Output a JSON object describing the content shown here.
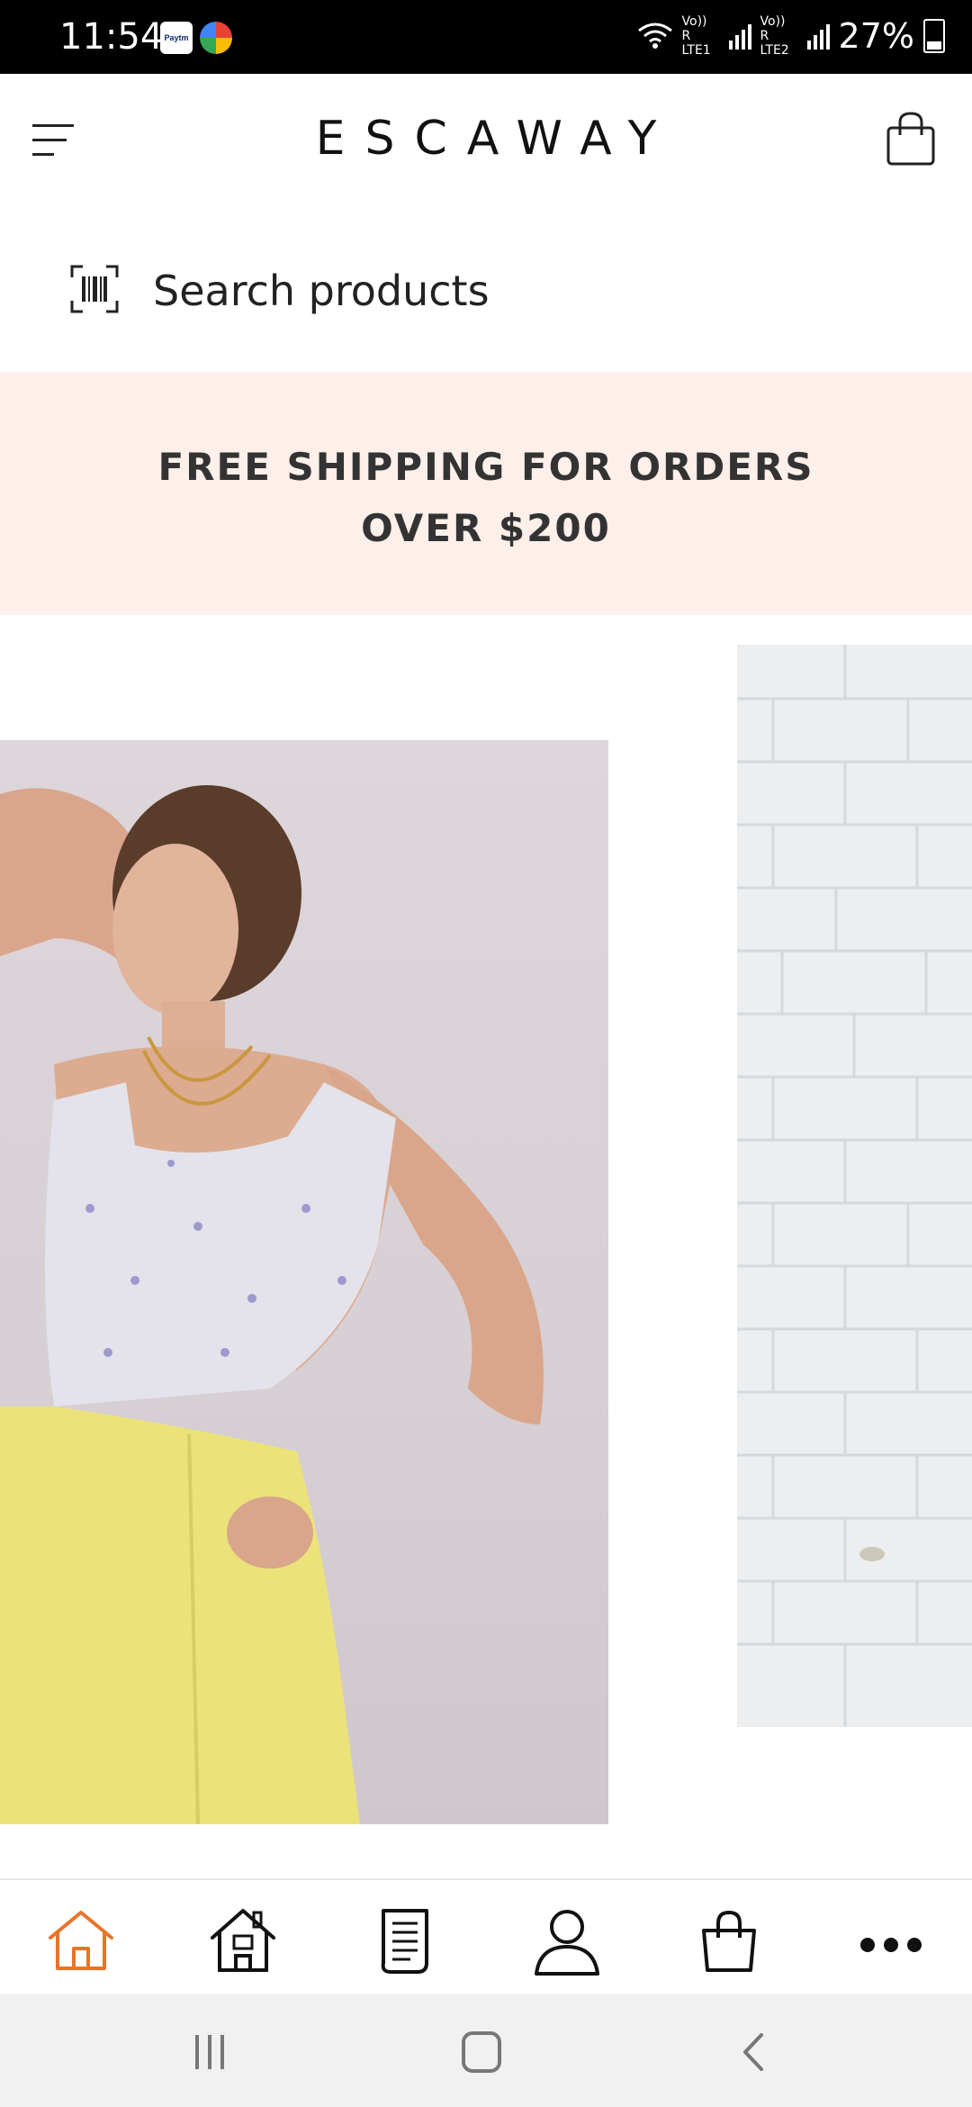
{
  "status_bar": {
    "time": "11:54",
    "paytm_label": "Paytm",
    "network1": "Vo)) R LTE1",
    "network2": "Vo)) R LTE2",
    "battery": "27%"
  },
  "header": {
    "brand": "ESCAWAY"
  },
  "search": {
    "placeholder": "Search products"
  },
  "banner": {
    "line1": "FREE SHIPPING FOR ORDERS",
    "line2": "OVER $200"
  },
  "bottom_nav": {
    "items": [
      "home-icon",
      "store-icon",
      "document-icon",
      "account-icon",
      "bag-icon",
      "more-icon"
    ],
    "active_color": "#e8742a"
  },
  "colors": {
    "banner_bg": "#fdefe9",
    "status_bar_bg": "#000000",
    "accent": "#e8742a"
  }
}
